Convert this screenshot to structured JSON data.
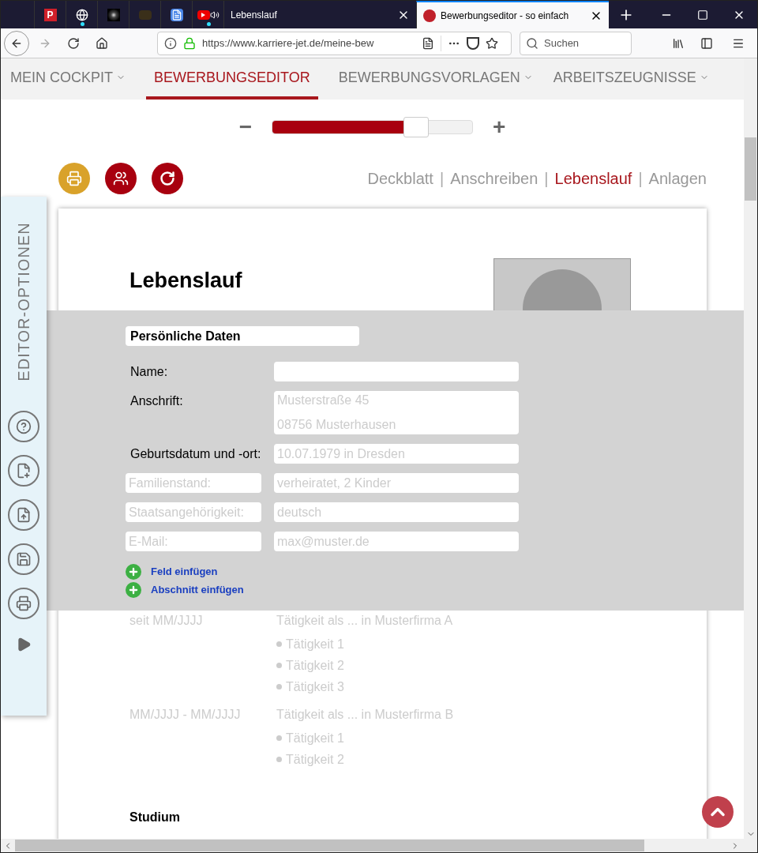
{
  "browser": {
    "tabs": [
      {
        "kind": "pinned",
        "label": "P",
        "attention": false,
        "selected": false
      },
      {
        "kind": "pinned",
        "attention": true,
        "selected": false
      },
      {
        "kind": "pinned",
        "attention": false,
        "selected": false
      },
      {
        "kind": "pinned",
        "attention": false,
        "selected": false
      },
      {
        "kind": "pinned",
        "attention": false,
        "selected": false
      },
      {
        "kind": "pinned",
        "attention": true,
        "selected": false
      },
      {
        "kind": "page",
        "label": "Lebenslauf",
        "selected": false
      },
      {
        "kind": "page",
        "label": "Bewerbungseditor - so einfach",
        "selected": true
      }
    ],
    "url": "https://www.karriere-jet.de/meine-bew",
    "search": {
      "placeholder": "Suchen"
    }
  },
  "nav": [
    {
      "label": "MEIN COCKPIT",
      "dropdown": true,
      "selected": false
    },
    {
      "label": "BEWERBUNGSEDITOR",
      "dropdown": false,
      "selected": true
    },
    {
      "label": "BEWERBUNGSVORLAGEN",
      "dropdown": true,
      "selected": false
    },
    {
      "label": "ARBEITSZEUGNISSE",
      "dropdown": true,
      "selected": false
    }
  ],
  "zoom": {
    "minus": "−",
    "plus": "+",
    "level": 0.72
  },
  "actions": [
    {
      "kind": "print",
      "color": "#d9a22a"
    },
    {
      "kind": "people",
      "color": "#a8000f"
    },
    {
      "kind": "refresh",
      "color": "#a8000f"
    }
  ],
  "doc_tabs": {
    "separator": "|",
    "items": [
      {
        "label": "Deckblatt",
        "selected": false
      },
      {
        "label": "Anschreiben",
        "selected": false
      },
      {
        "label": "Lebenslauf",
        "selected": true
      },
      {
        "label": "Anlagen",
        "selected": false
      }
    ]
  },
  "document": {
    "title": "Lebenslauf",
    "section": {
      "heading": "Persönliche Daten",
      "rows": [
        {
          "kind": "fixed",
          "label": "Name:"
        },
        {
          "kind": "fixed",
          "label": "Anschrift:",
          "placeholder_lines": [
            "Musterstraße 45",
            "08756 Musterhausen"
          ]
        },
        {
          "kind": "fixed",
          "label": "Geburtsdatum und -ort:",
          "placeholder": "10.07.1979 in Dresden"
        },
        {
          "kind": "custom",
          "label_placeholder": "Familienstand:",
          "placeholder": "verheiratet, 2 Kinder"
        },
        {
          "kind": "custom",
          "label_placeholder": "Staatsangehörigkeit:",
          "placeholder": "deutsch"
        },
        {
          "kind": "custom",
          "label_placeholder": "E-Mail:",
          "placeholder": "max@muster.de"
        }
      ],
      "links": [
        "Feld einfügen",
        "Abschnitt einfügen"
      ]
    },
    "entries": [
      {
        "date": "seit MM/JJJJ",
        "title": "Tätigkeit als ... in Musterfirma A",
        "bullets": [
          "Tätigkeit 1",
          "Tätigkeit 2",
          "Tätigkeit 3"
        ]
      },
      {
        "date": "MM/JJJJ - MM/JJJJ",
        "title": "Tätigkeit als ... in Musterfirma B",
        "bullets": [
          "Tätigkeit 1",
          "Tätigkeit 2"
        ]
      }
    ],
    "next_heading": "Studium"
  },
  "editor_panel": {
    "title": "EDITOR-OPTIONEN",
    "tools": [
      {
        "kind": "help"
      },
      {
        "kind": "add-page"
      },
      {
        "kind": "upload"
      },
      {
        "kind": "save"
      },
      {
        "kind": "print"
      },
      {
        "kind": "expand"
      }
    ]
  }
}
